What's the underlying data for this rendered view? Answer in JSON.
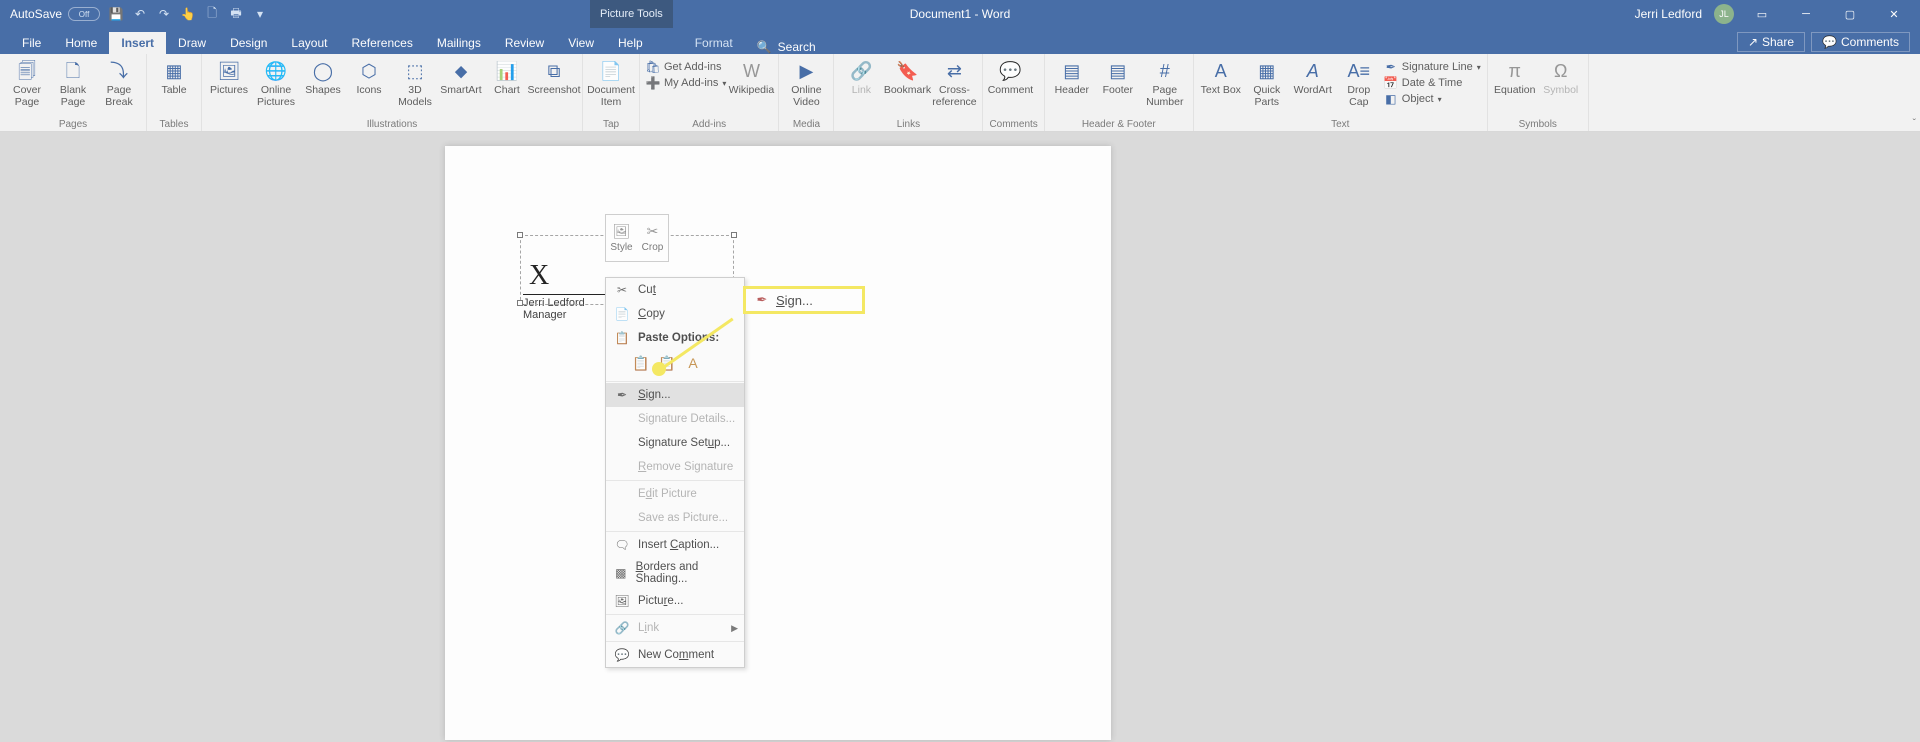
{
  "titlebar": {
    "autosave_label": "AutoSave",
    "autosave_state": "Off",
    "picture_tools": "Picture Tools",
    "doc_title": "Document1  -  Word",
    "user_name": "Jerri Ledford",
    "user_initials": "JL"
  },
  "tabs": {
    "file": "File",
    "home": "Home",
    "insert": "Insert",
    "draw": "Draw",
    "design": "Design",
    "layout": "Layout",
    "references": "References",
    "mailings": "Mailings",
    "review": "Review",
    "view": "View",
    "help": "Help",
    "format": "Format",
    "search": "Search",
    "share": "Share",
    "comments": "Comments"
  },
  "ribbon": {
    "pages": {
      "label": "Pages",
      "cover": "Cover Page",
      "blank": "Blank Page",
      "break": "Page Break"
    },
    "tables": {
      "label": "Tables",
      "table": "Table"
    },
    "illustrations": {
      "label": "Illustrations",
      "pictures": "Pictures",
      "online": "Online Pictures",
      "shapes": "Shapes",
      "icons": "Icons",
      "models": "3D Models",
      "smartart": "SmartArt",
      "chart": "Chart",
      "screenshot": "Screenshot"
    },
    "tap": {
      "label": "Tap",
      "doc_item": "Document Item"
    },
    "addins": {
      "label": "Add-ins",
      "get": "Get Add-ins",
      "my": "My Add-ins",
      "wiki": "Wikipedia"
    },
    "media": {
      "label": "Media",
      "video": "Online Video"
    },
    "links": {
      "label": "Links",
      "link": "Link",
      "bookmark": "Bookmark",
      "cross": "Cross-reference"
    },
    "comments": {
      "label": "Comments",
      "comment": "Comment"
    },
    "hf": {
      "label": "Header & Footer",
      "header": "Header",
      "footer": "Footer",
      "pagenum": "Page Number"
    },
    "text": {
      "label": "Text",
      "textbox": "Text Box",
      "quick": "Quick Parts",
      "wordart": "WordArt",
      "drop": "Drop Cap",
      "sig": "Signature Line",
      "date": "Date & Time",
      "object": "Object"
    },
    "symbols": {
      "label": "Symbols",
      "equation": "Equation",
      "symbol": "Symbol"
    }
  },
  "signature": {
    "x": "X",
    "name": "Jerri Ledford",
    "title": "Manager"
  },
  "mini": {
    "style": "Style",
    "crop": "Crop"
  },
  "ctx": {
    "cut": "Cut",
    "copy": "Copy",
    "paste_options": "Paste Options:",
    "sign": "Sign...",
    "details": "Signature Details...",
    "setup": "Signature Setup...",
    "remove": "Remove Signature",
    "edit_pic": "Edit Picture",
    "save_as_pic": "Save as Picture...",
    "caption": "Insert Caption...",
    "borders": "Borders and Shading...",
    "picture": "Picture...",
    "link": "Link",
    "new_comment": "New Comment"
  },
  "callout": {
    "sign": "Sign..."
  }
}
